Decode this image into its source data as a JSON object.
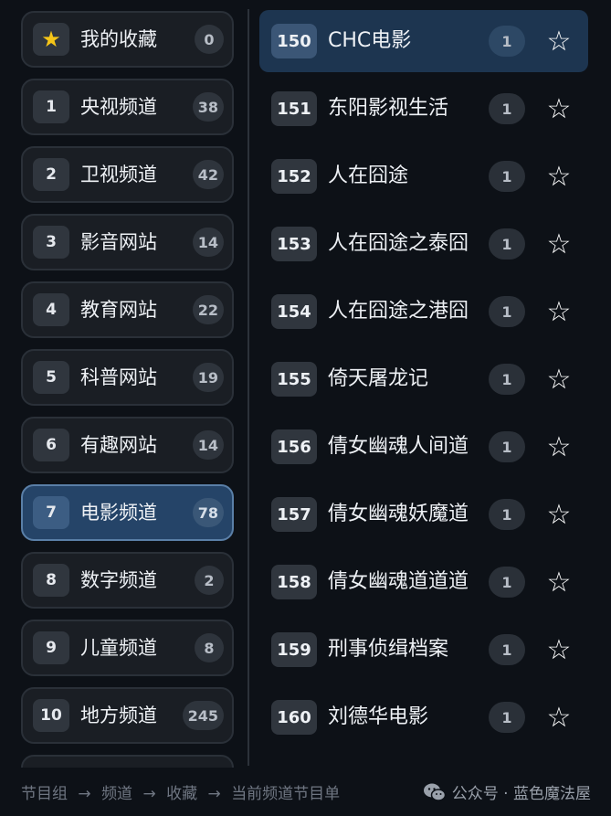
{
  "groups": [
    {
      "num": "★",
      "label": "我的收藏",
      "count": "0",
      "is_favorites": true
    },
    {
      "num": "1",
      "label": "央视频道",
      "count": "38"
    },
    {
      "num": "2",
      "label": "卫视频道",
      "count": "42"
    },
    {
      "num": "3",
      "label": "影音网站",
      "count": "14"
    },
    {
      "num": "4",
      "label": "教育网站",
      "count": "22"
    },
    {
      "num": "5",
      "label": "科普网站",
      "count": "19"
    },
    {
      "num": "6",
      "label": "有趣网站",
      "count": "14"
    },
    {
      "num": "7",
      "label": "电影频道",
      "count": "78",
      "active": true
    },
    {
      "num": "8",
      "label": "数字频道",
      "count": "2"
    },
    {
      "num": "9",
      "label": "儿童频道",
      "count": "8"
    },
    {
      "num": "10",
      "label": "地方频道",
      "count": "245"
    },
    {
      "num": "",
      "label": "",
      "count": ""
    }
  ],
  "channels": [
    {
      "num": "150",
      "name": "CHC电影",
      "count": "1",
      "star": "☆",
      "active": true
    },
    {
      "num": "151",
      "name": "东阳影视生活",
      "count": "1",
      "star": "☆"
    },
    {
      "num": "152",
      "name": "人在囧途",
      "count": "1",
      "star": "☆"
    },
    {
      "num": "153",
      "name": "人在囧途之泰囧",
      "count": "1",
      "star": "☆"
    },
    {
      "num": "154",
      "name": "人在囧途之港囧",
      "count": "1",
      "star": "☆"
    },
    {
      "num": "155",
      "name": "倚天屠龙记",
      "count": "1",
      "star": "☆"
    },
    {
      "num": "156",
      "name": "倩女幽魂人间道",
      "count": "1",
      "star": "☆"
    },
    {
      "num": "157",
      "name": "倩女幽魂妖魔道",
      "count": "1",
      "star": "☆"
    },
    {
      "num": "158",
      "name": "倩女幽魂道道道",
      "count": "1",
      "star": "☆"
    },
    {
      "num": "159",
      "name": "刑事侦缉档案",
      "count": "1",
      "star": "☆"
    },
    {
      "num": "160",
      "name": "刘德华电影",
      "count": "1",
      "star": "☆"
    }
  ],
  "footer": {
    "breadcrumb": [
      "节目组",
      "→",
      "频道",
      "→",
      "收藏",
      "→",
      "当前频道节目单"
    ],
    "watermark": "公众号 · 蓝色魔法屋"
  },
  "colors": {
    "background": "#0d1117",
    "active_group": "#254468",
    "active_channel": "#1d3550",
    "favorites_star": "#f5c518"
  }
}
